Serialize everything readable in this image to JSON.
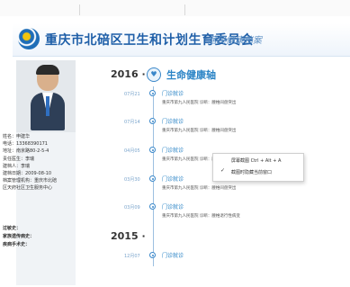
{
  "header": {
    "title": "重庆市北碚区卫生和计划生育委员会",
    "subtitle": "居民健康档案"
  },
  "profile": {
    "fields": [
      "姓名：申建华",
      "电话：13368390171",
      "地址：南京路80-2-5-4",
      "责任医生：李瑞",
      "建档人：李瑞",
      "建档日期：2009-08-10",
      "档案管理机构：重庆市北碚区天府社区卫生服务中心"
    ],
    "extra": [
      "过敏史：",
      "家族遗传病史：",
      "疾病手术史："
    ]
  },
  "timeline": {
    "year_main": "2016",
    "section_label": "生命健康轴",
    "year_2": "2015",
    "events": [
      {
        "date": "07月21",
        "title": "门诊就诊",
        "desc": "重庆市第九人民医院 诊断：腰椎间盘突出"
      },
      {
        "date": "07月14",
        "title": "门诊就诊",
        "desc": "重庆市第九人民医院 诊断：腰椎间盘突出"
      },
      {
        "date": "04月05",
        "title": "门诊就诊",
        "desc": "重庆市第九人民医院 诊断：腰椎间盘突出"
      },
      {
        "date": "03月30",
        "title": "门诊就诊",
        "desc": "重庆市第九人民医院 诊断：腰椎间盘突出"
      },
      {
        "date": "03月09",
        "title": "门诊就诊",
        "desc": "重庆市第九人民医院 诊断：腰椎退行性病变"
      }
    ],
    "event_2015": {
      "date": "12月07",
      "title": "门诊就诊"
    }
  },
  "context_menu": {
    "items": [
      "屏幕截图 Ctrl + Alt + A",
      "截图时隐藏当前窗口"
    ],
    "checked_index": 1
  },
  "icons": {
    "logo": "health-commission-logo-icon",
    "year": "stethoscope-icon",
    "check": "check-icon"
  }
}
